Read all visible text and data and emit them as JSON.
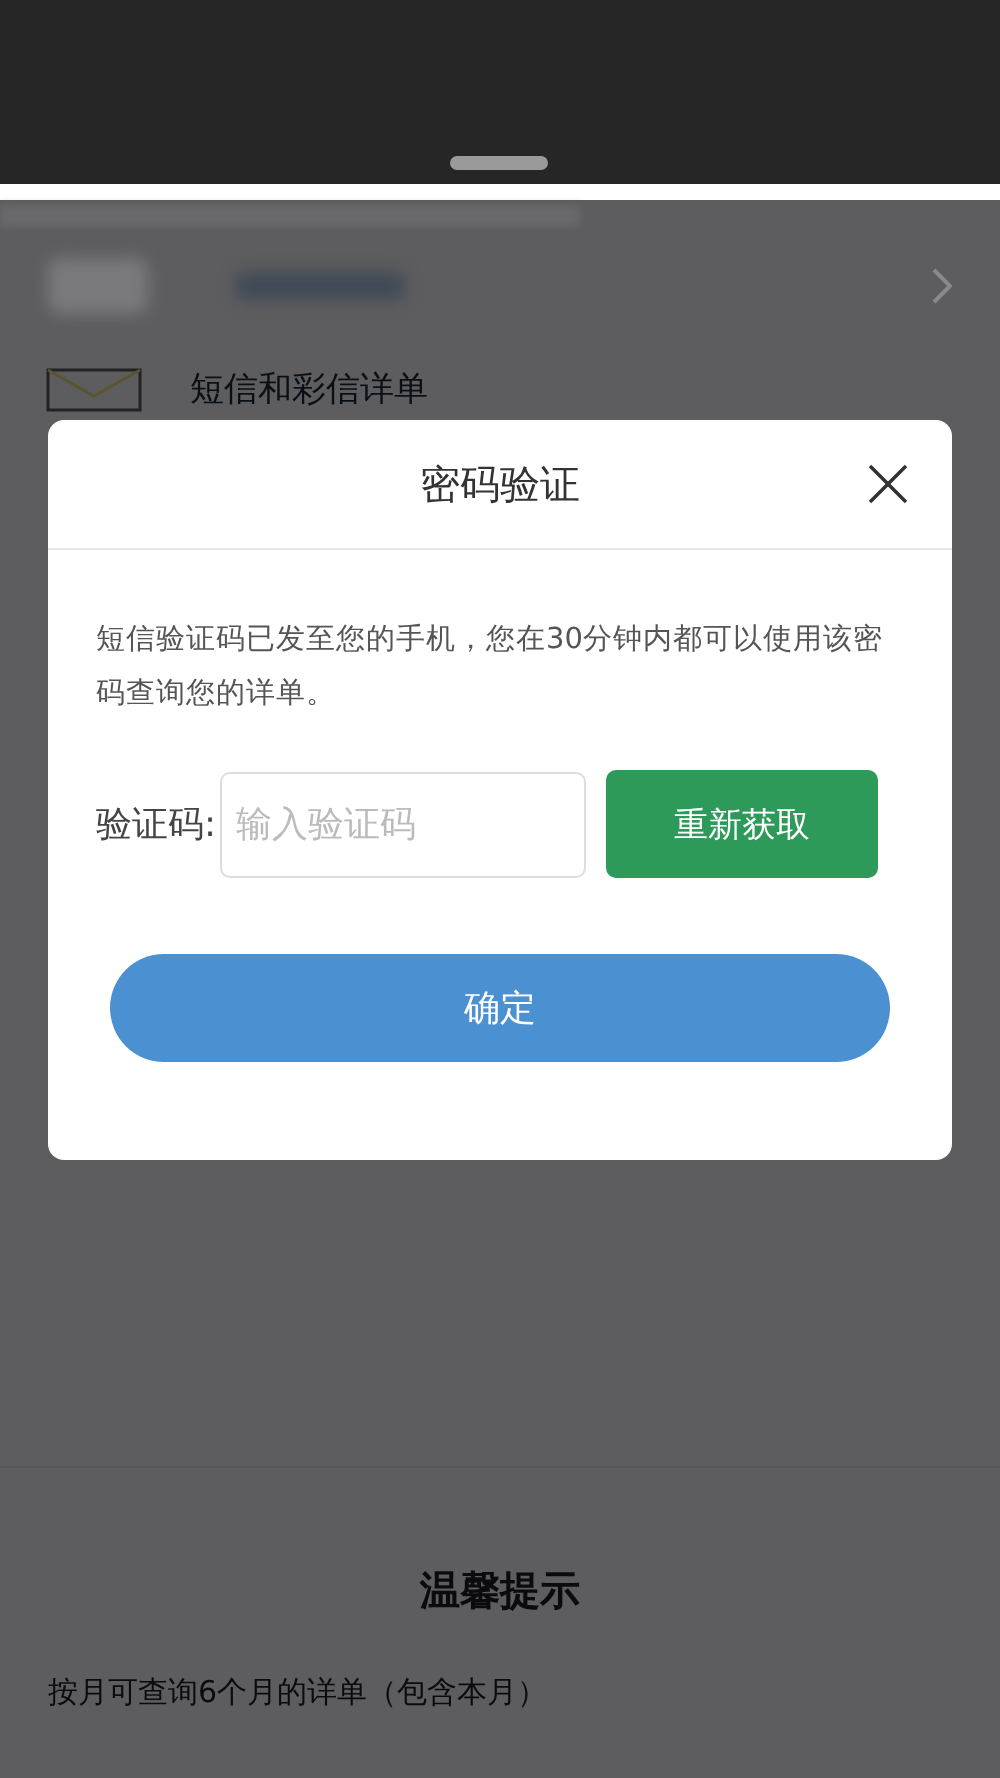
{
  "background": {
    "list_item": {
      "label": "短信和彩信详单"
    },
    "tips": {
      "title": "温馨提示",
      "text": "按月可查询6个月的详单（包含本月）"
    }
  },
  "dialog": {
    "title": "密码验证",
    "message": "短信验证码已发至您的手机，您在30分钟内都可以使用该密码查询您的详单。",
    "code_label": "验证码:",
    "code_field": {
      "placeholder": "输入验证码"
    },
    "resend_button": "重新获取",
    "confirm_button": "确定"
  }
}
